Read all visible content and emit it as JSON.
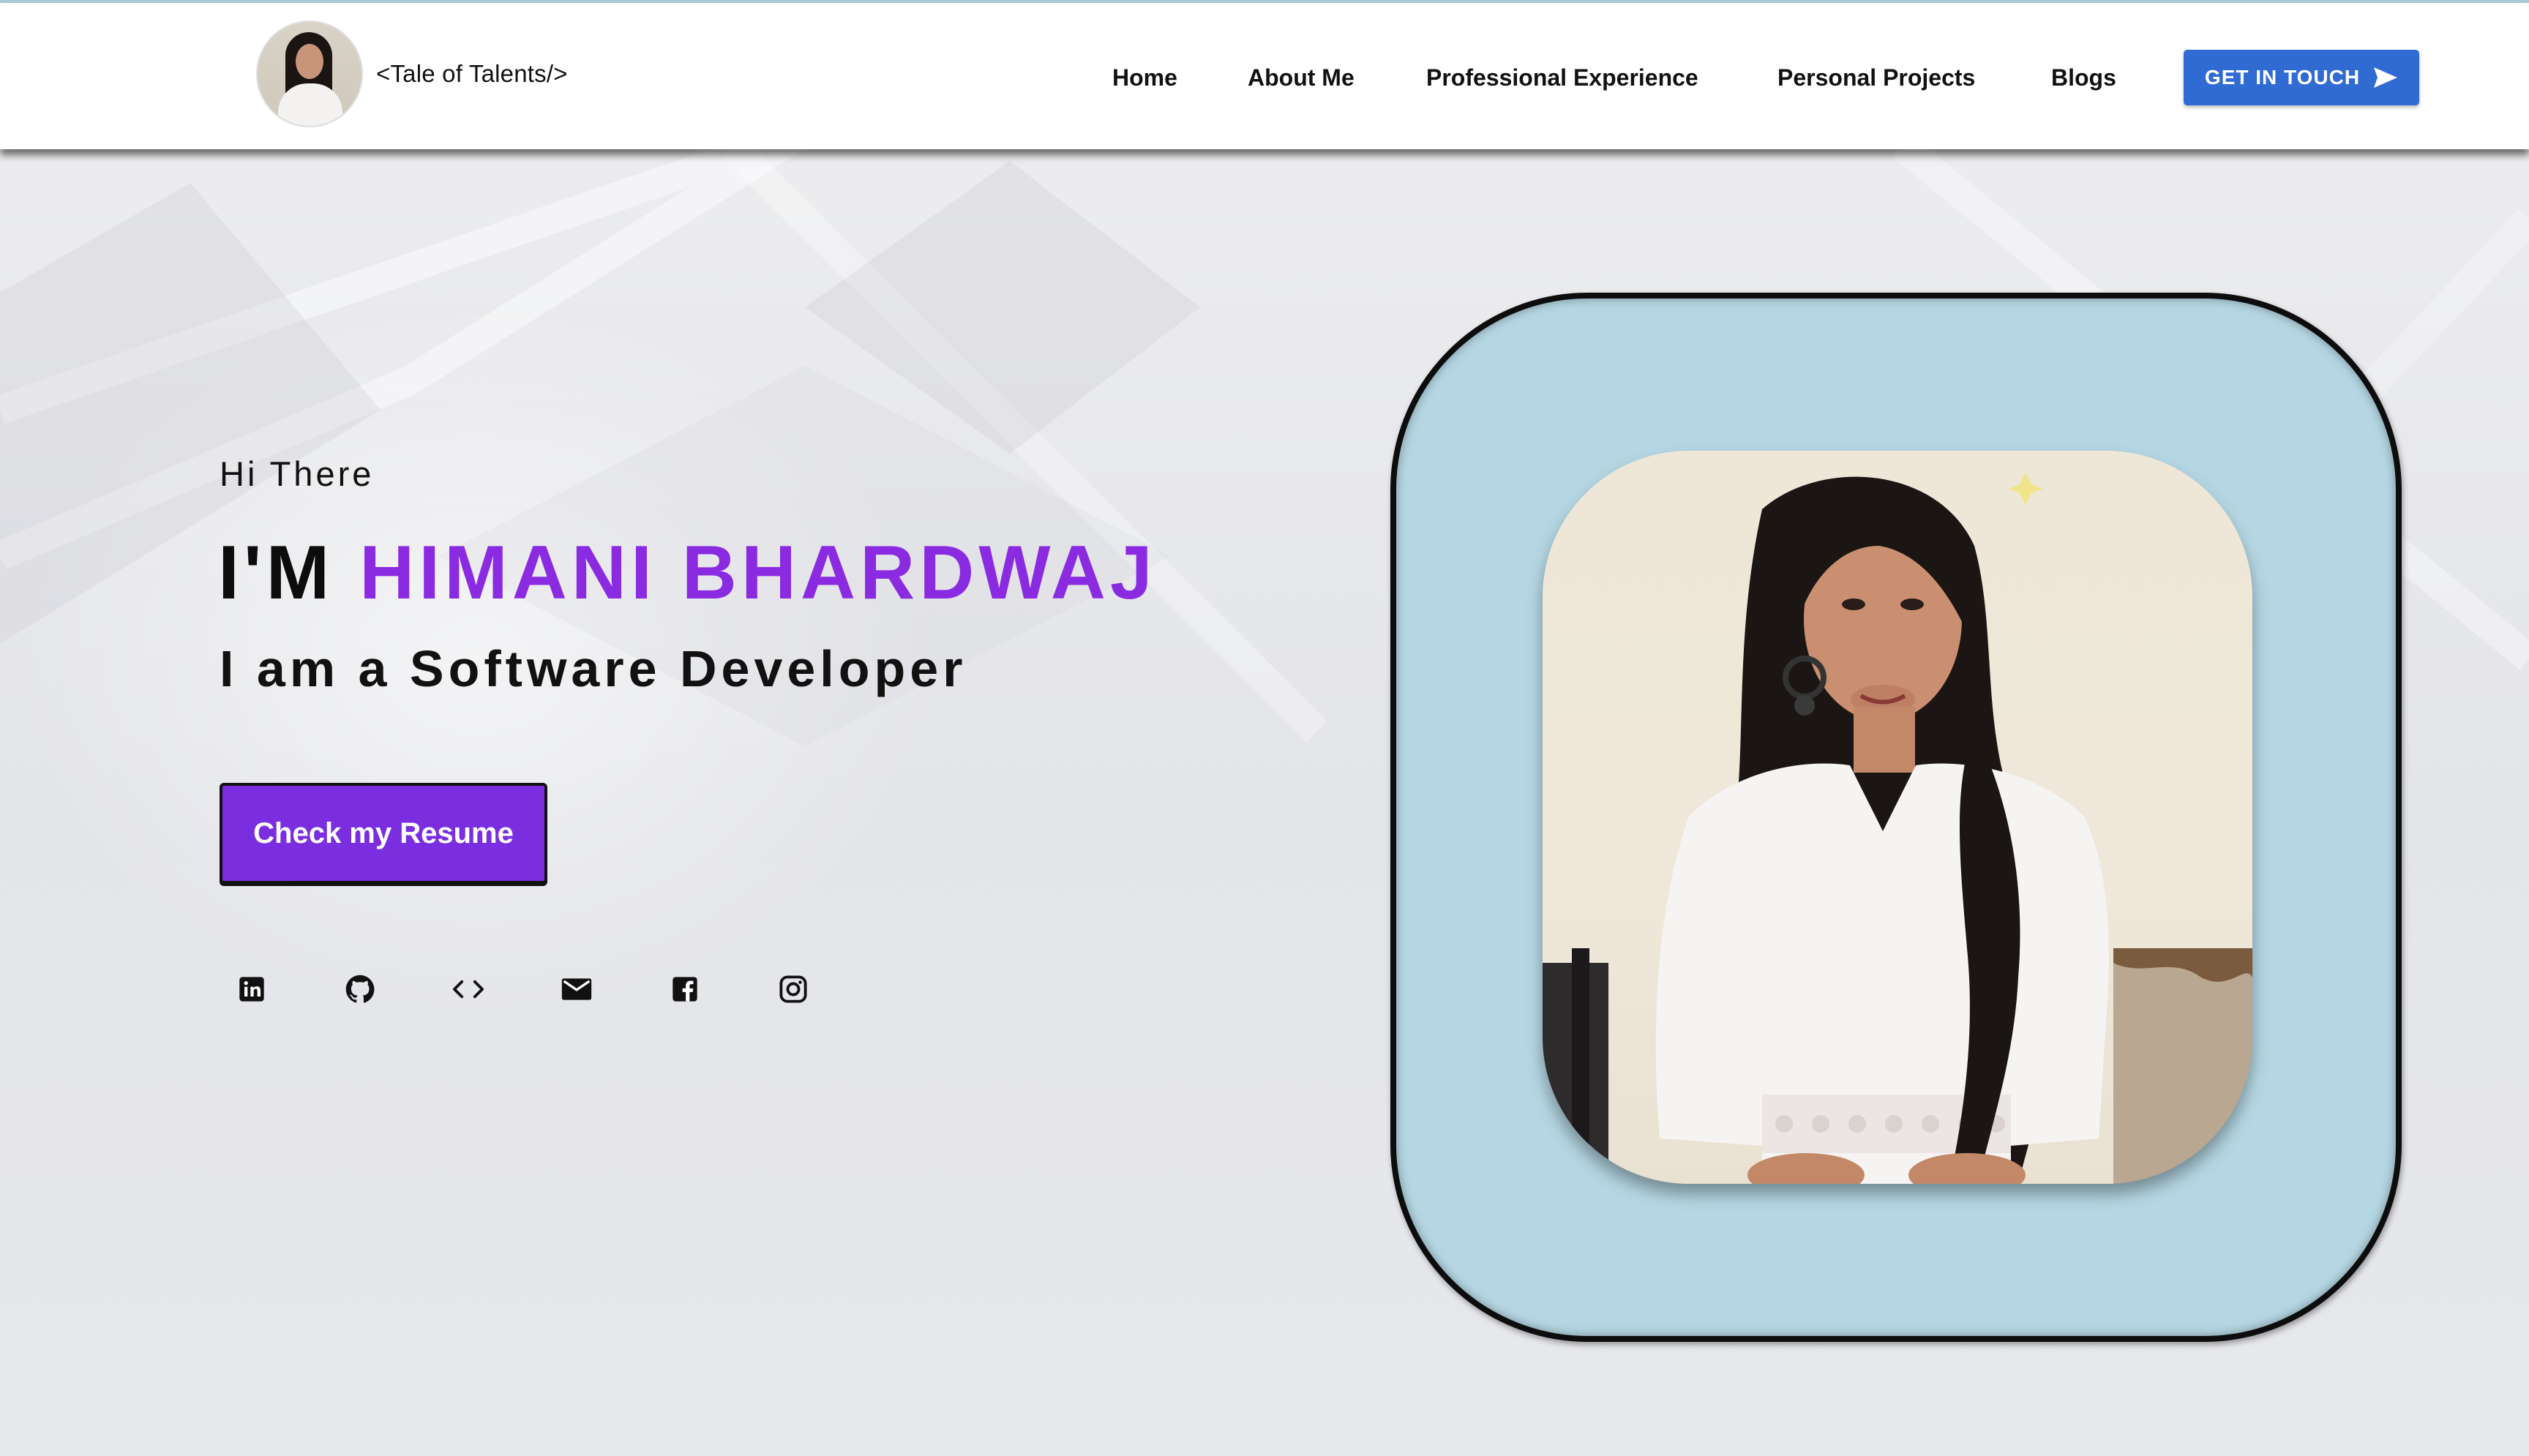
{
  "header": {
    "brand_name": "<Tale of Talents/>",
    "nav": [
      "Home",
      "About Me",
      "Professional Experience",
      "Personal Projects",
      "Blogs"
    ],
    "cta_label": "GET IN TOUCH",
    "cta_icon": "send-icon"
  },
  "hero": {
    "greeting": "Hi There",
    "title_prefix": "I'M ",
    "name": "HIMANI BHARDWAJ",
    "role": "I am a Software Developer",
    "resume_button": "Check my Resume",
    "socials": [
      "linkedin-icon",
      "github-icon",
      "code-icon",
      "mail-icon",
      "facebook-icon",
      "instagram-icon"
    ]
  },
  "colors": {
    "accent_purple": "#7b2ee0",
    "name_purple": "#8a2be2",
    "cta_blue": "#2f6bd3",
    "card_blue": "#b5d7e3"
  }
}
